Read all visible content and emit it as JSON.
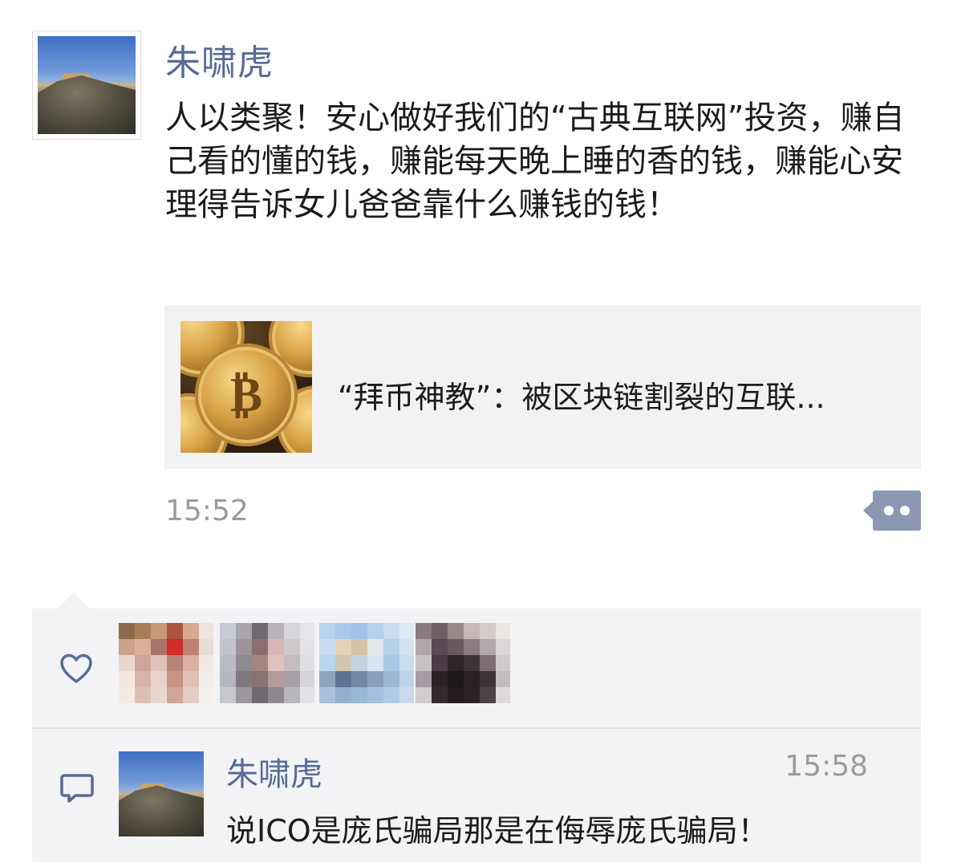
{
  "post": {
    "author": "朱啸虎",
    "text": "人以类聚！安心做好我们的“古典互联网”投资，赚自己看的懂的钱，赚能每天晚上睡的香的钱，赚能心安理得告诉女儿爸爸靠什么赚钱的钱！",
    "link_card": {
      "title": "“拜币神教”：被区块链割裂的互联..."
    },
    "time": "15:52",
    "more_icon": "more-options-icon"
  },
  "interactions": {
    "like_icon": "heart-icon",
    "comment_icon": "comment-icon",
    "comments": [
      {
        "author": "朱啸虎",
        "time": "15:58",
        "text": "说ICO是庞氏骗局那是在侮辱庞氏骗局！"
      }
    ]
  },
  "colors": {
    "name_link": "#576b95",
    "meta_gray": "#9b9b9b",
    "card_bg": "#f2f2f2",
    "interaction_bg": "#f3f3f5",
    "more_button": "#8a98b3"
  }
}
